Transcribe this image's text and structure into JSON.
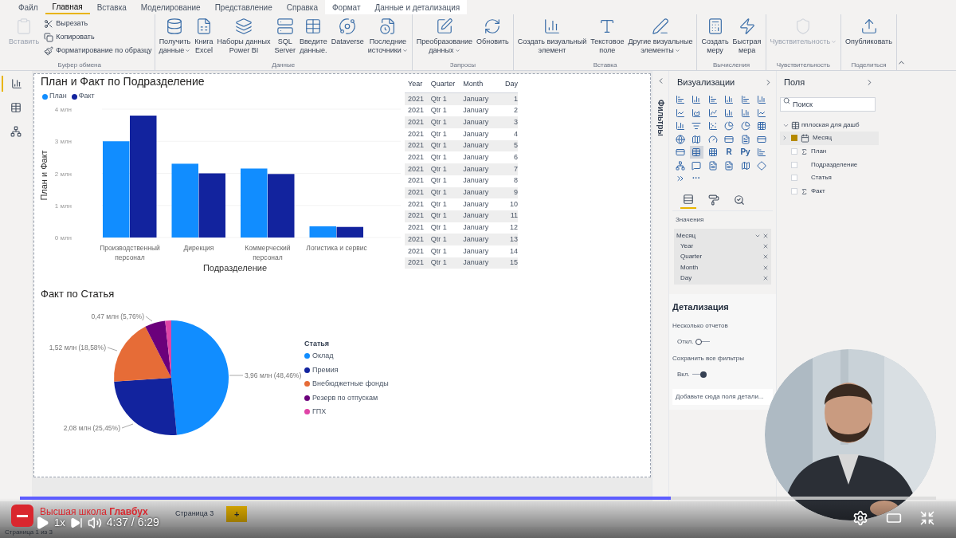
{
  "ribbon": {
    "tabs": [
      {
        "label": "Файл",
        "selected": false,
        "kind": "plain"
      },
      {
        "label": "Главная",
        "selected": true,
        "kind": "plain"
      },
      {
        "label": "Вставка",
        "selected": false,
        "kind": "plain"
      },
      {
        "label": "Моделирование",
        "selected": false,
        "kind": "plain"
      },
      {
        "label": "Представление",
        "selected": false,
        "kind": "plain"
      },
      {
        "label": "Справка",
        "selected": false,
        "kind": "plain"
      },
      {
        "label": "Формат",
        "selected": false,
        "kind": "context"
      },
      {
        "label": "Данные и детализация",
        "selected": false,
        "kind": "context"
      }
    ],
    "groups": [
      {
        "label": "Буфер обмена",
        "buttons": [
          {
            "kind": "large",
            "lines": [
              "Вставить"
            ],
            "disabled": true,
            "menu": false
          },
          {
            "kind": "small",
            "lines": [
              "Вырезать"
            ],
            "disabled": false,
            "menu": false
          },
          {
            "kind": "small",
            "lines": [
              "Копировать"
            ],
            "disabled": false,
            "menu": false
          },
          {
            "kind": "small",
            "lines": [
              "Форматирование по образцу"
            ],
            "disabled": false,
            "menu": false
          }
        ]
      },
      {
        "label": "Данные",
        "buttons": [
          {
            "kind": "large",
            "lines": [
              "Получить",
              "данные"
            ],
            "disabled": false,
            "menu": true
          },
          {
            "kind": "large",
            "lines": [
              "Книга",
              "Excel"
            ],
            "disabled": false,
            "menu": false
          },
          {
            "kind": "large",
            "lines": [
              "Наборы данных",
              "Power BI"
            ],
            "disabled": false,
            "menu": false
          },
          {
            "kind": "large",
            "lines": [
              "SQL",
              "Server"
            ],
            "disabled": false,
            "menu": false
          },
          {
            "kind": "large",
            "lines": [
              "Введите",
              "данные."
            ],
            "disabled": false,
            "menu": false
          },
          {
            "kind": "large",
            "lines": [
              "Dataverse"
            ],
            "disabled": false,
            "menu": false
          },
          {
            "kind": "large",
            "lines": [
              "Последние",
              "источники"
            ],
            "disabled": false,
            "menu": true
          }
        ]
      },
      {
        "label": "Запросы",
        "buttons": [
          {
            "kind": "large",
            "lines": [
              "Преобразование",
              "данных"
            ],
            "disabled": false,
            "menu": true
          },
          {
            "kind": "large",
            "lines": [
              "Обновить"
            ],
            "disabled": false,
            "menu": false
          }
        ]
      },
      {
        "label": "Вставка",
        "buttons": [
          {
            "kind": "large",
            "lines": [
              "Создать визуальный",
              "элемент"
            ],
            "disabled": false,
            "menu": false
          },
          {
            "kind": "large",
            "lines": [
              "Текстовое",
              "поле"
            ],
            "disabled": false,
            "menu": false
          },
          {
            "kind": "large",
            "lines": [
              "Другие визуальные",
              "элементы"
            ],
            "disabled": false,
            "menu": true
          }
        ]
      },
      {
        "label": "Вычисления",
        "buttons": [
          {
            "kind": "large",
            "lines": [
              "Создать",
              "меру"
            ],
            "disabled": false,
            "menu": false
          },
          {
            "kind": "large",
            "lines": [
              "Быстрая",
              "мера"
            ],
            "disabled": false,
            "menu": false
          }
        ]
      },
      {
        "label": "Чувствительность",
        "buttons": [
          {
            "kind": "large",
            "lines": [
              "Чувствительность"
            ],
            "disabled": true,
            "menu": true
          }
        ]
      },
      {
        "label": "Поделиться",
        "buttons": [
          {
            "kind": "large",
            "lines": [
              "Опубликовать"
            ],
            "disabled": false,
            "menu": false
          }
        ]
      }
    ]
  },
  "left_nav": [
    {
      "selected": true
    },
    {
      "selected": false
    },
    {
      "selected": false
    }
  ],
  "canvas": {
    "bar_chart": {
      "chart_data": {
        "type": "bar",
        "title": "План и Факт по Подразделение",
        "xlabel": "Подразделение",
        "ylabel": "План и Факт",
        "categories": [
          "Производственный персонал",
          "Дирекция",
          "Коммерческий персонал",
          "Логистика и сервис"
        ],
        "series": [
          {
            "name": "План",
            "color": "#118dff",
            "values": [
              3.0,
              2.3,
              2.15,
              0.35
            ]
          },
          {
            "name": "Факт",
            "color": "#12239e",
            "values": [
              3.8,
              2.0,
              1.98,
              0.33
            ]
          }
        ],
        "ylim": [
          0,
          4
        ],
        "grid": true,
        "legend": true,
        "yticks": [
          {
            "value": 0,
            "label": "0 млн"
          },
          {
            "value": 1,
            "label": "1 млн"
          },
          {
            "value": 2,
            "label": "2 млн"
          },
          {
            "value": 3,
            "label": "3 млн"
          },
          {
            "value": 4,
            "label": "4 млн"
          }
        ]
      }
    },
    "table": {
      "columns": [
        "Year",
        "Quarter",
        "Month",
        "Day"
      ],
      "rows": [
        [
          "2021",
          "Qtr 1",
          "January",
          "1"
        ],
        [
          "2021",
          "Qtr 1",
          "January",
          "2"
        ],
        [
          "2021",
          "Qtr 1",
          "January",
          "3"
        ],
        [
          "2021",
          "Qtr 1",
          "January",
          "4"
        ],
        [
          "2021",
          "Qtr 1",
          "January",
          "5"
        ],
        [
          "2021",
          "Qtr 1",
          "January",
          "6"
        ],
        [
          "2021",
          "Qtr 1",
          "January",
          "7"
        ],
        [
          "2021",
          "Qtr 1",
          "January",
          "8"
        ],
        [
          "2021",
          "Qtr 1",
          "January",
          "9"
        ],
        [
          "2021",
          "Qtr 1",
          "January",
          "10"
        ],
        [
          "2021",
          "Qtr 1",
          "January",
          "11"
        ],
        [
          "2021",
          "Qtr 1",
          "January",
          "12"
        ],
        [
          "2021",
          "Qtr 1",
          "January",
          "13"
        ],
        [
          "2021",
          "Qtr 1",
          "January",
          "14"
        ],
        [
          "2021",
          "Qtr 1",
          "January",
          "15"
        ]
      ]
    },
    "pie_chart": {
      "slices": [
        {
          "color": "#118dff"
        },
        {
          "color": "#12239e"
        },
        {
          "color": "#e66c37"
        },
        {
          "color": "#6b007b"
        },
        {
          "color": "#e044a7"
        }
      ],
      "chart_data": {
        "type": "pie",
        "title": "Факт по Статья",
        "legend": {
          "title": "Статья"
        },
        "categories": [
          "Оклад",
          "Премия",
          "Внебюджетные фонды",
          "Резерв по отпускам",
          "ГПХ"
        ],
        "values": [
          3.96,
          2.08,
          1.52,
          0.47,
          0.14
        ],
        "value_labels": [
          "3,96 млн (48,46%)",
          "2,08 млн (25,45%)",
          "1,52 млн (18,58%)",
          "0,47 млн (5,76%)",
          null
        ]
      }
    }
  },
  "filters_pane": {
    "title": "Фильтры"
  },
  "visualizations": {
    "title": "Визуализации",
    "gallery": [
      {
        "kind": "icon",
        "selected": false
      },
      {
        "kind": "icon",
        "selected": false
      },
      {
        "kind": "icon",
        "selected": false
      },
      {
        "kind": "icon",
        "selected": false
      },
      {
        "kind": "icon",
        "selected": false
      },
      {
        "kind": "icon",
        "selected": false
      },
      {
        "kind": "icon",
        "selected": false
      },
      {
        "kind": "icon",
        "selected": false
      },
      {
        "kind": "icon",
        "selected": false
      },
      {
        "kind": "icon",
        "selected": false
      },
      {
        "kind": "icon",
        "selected": false
      },
      {
        "kind": "icon",
        "selected": false
      },
      {
        "kind": "icon",
        "selected": false
      },
      {
        "kind": "icon",
        "selected": false
      },
      {
        "kind": "icon",
        "selected": false
      },
      {
        "kind": "icon",
        "selected": false
      },
      {
        "kind": "icon",
        "selected": false
      },
      {
        "kind": "icon",
        "selected": false
      },
      {
        "kind": "icon",
        "selected": false
      },
      {
        "kind": "icon",
        "selected": false
      },
      {
        "kind": "icon",
        "selected": false
      },
      {
        "kind": "icon",
        "selected": false
      },
      {
        "kind": "icon",
        "selected": false
      },
      {
        "kind": "icon",
        "selected": false
      },
      {
        "kind": "icon",
        "selected": false
      },
      {
        "kind": "icon",
        "selected": true
      },
      {
        "kind": "icon",
        "selected": false
      },
      {
        "kind": "text",
        "text": "R",
        "selected": false
      },
      {
        "kind": "text",
        "text": "Py",
        "selected": false
      },
      {
        "kind": "icon",
        "selected": false
      },
      {
        "kind": "icon",
        "selected": false
      },
      {
        "kind": "icon",
        "selected": false
      },
      {
        "kind": "icon",
        "selected": false
      },
      {
        "kind": "icon",
        "selected": false
      },
      {
        "kind": "icon",
        "selected": false
      },
      {
        "kind": "icon",
        "selected": false
      },
      {
        "kind": "icon",
        "selected": false
      },
      {
        "kind": "text",
        "text": "···",
        "selected": false
      }
    ],
    "tabs": [
      {
        "selected": true
      },
      {
        "selected": false
      },
      {
        "selected": false
      }
    ],
    "well_label": "Значения",
    "well": [
      {
        "label": "Месяц",
        "kind": "group"
      },
      {
        "label": "Year",
        "kind": "level"
      },
      {
        "label": "Quarter",
        "kind": "level"
      },
      {
        "label": "Month",
        "kind": "level"
      },
      {
        "label": "Day",
        "kind": "level"
      }
    ],
    "drill": {
      "title": "Детализация",
      "options": [
        {
          "label": "Несколько отчетов",
          "state": "Откл.",
          "on": false
        },
        {
          "label": "Сохранить все фильтры",
          "state": "Вкл.",
          "on": true
        }
      ],
      "drop_hint": "Добавьте сюда поля детали..."
    }
  },
  "fields": {
    "title": "Поля",
    "search": {
      "placeholder": "Поиск"
    },
    "tree": [
      {
        "label": "пплоская для дашб",
        "kind": "table",
        "expanded": true,
        "children": [
          {
            "label": "Месяц",
            "kind": "hierarchy",
            "checked": true,
            "expanded": false
          },
          {
            "label": "План",
            "kind": "measure",
            "checked": false
          },
          {
            "label": "Подразделение",
            "kind": "field",
            "checked": false
          },
          {
            "label": "Статья",
            "kind": "field",
            "checked": false
          },
          {
            "label": "Факт",
            "kind": "measure",
            "checked": false
          }
        ]
      }
    ]
  },
  "pages": {
    "tabs": [
      {
        "label": "Страница 3",
        "selected": false
      }
    ],
    "add": "+"
  },
  "status_bar": "Страница 1 из 3",
  "player": {
    "logo": "Высшая школа **Главбух**",
    "speed": "1x",
    "time": "4:37 / 6:29",
    "progress": {
      "level": 0.71
    }
  }
}
